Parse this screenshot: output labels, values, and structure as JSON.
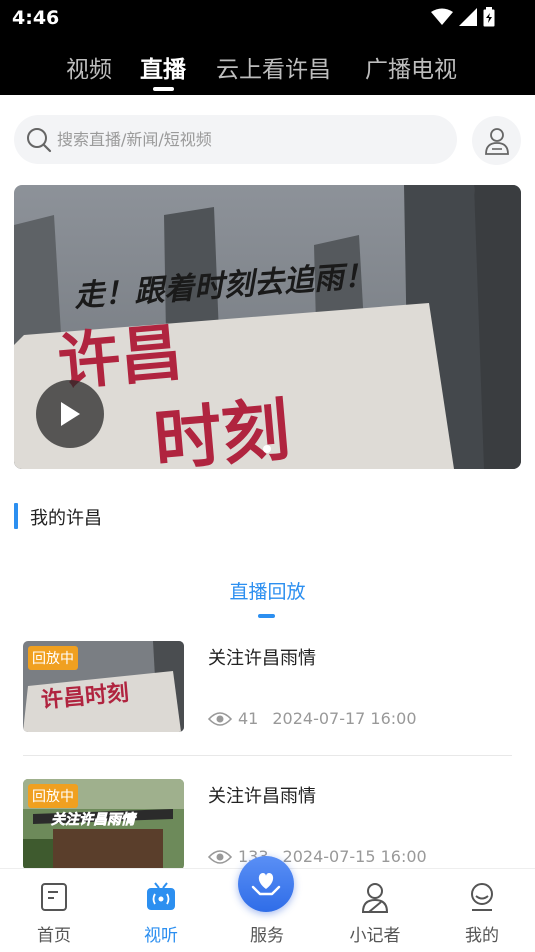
{
  "status_bar": {
    "time": "4:46"
  },
  "top_tabs": [
    {
      "label": "视频"
    },
    {
      "label": "直播"
    },
    {
      "label": "云上看许昌"
    },
    {
      "label": "广播电视"
    }
  ],
  "active_top_tab": "直播",
  "search": {
    "placeholder": "搜索直播/新闻/短视频"
  },
  "banner": {
    "headline": "走！跟着时刻去追雨！",
    "sign_text_line1": "许昌",
    "sign_text_line2": "时刻",
    "active_dot": 1,
    "dot_count": 1
  },
  "section": {
    "title": "我的许昌"
  },
  "sub_tab": {
    "label": "直播回放"
  },
  "list": [
    {
      "badge": "回放中",
      "title": "关注许昌雨情",
      "views": "41",
      "date": "2024-07-17 16:00",
      "thumb_text": "许昌时刻"
    },
    {
      "badge": "回放中",
      "title": "关注许昌雨情",
      "views": "133",
      "date": "2024-07-15 16:00",
      "thumb_text": "关注许昌雨情"
    }
  ],
  "bottom_nav": [
    {
      "label": "首页",
      "icon": "home-doc-icon"
    },
    {
      "label": "视听",
      "icon": "tv-icon"
    },
    {
      "label": "服务",
      "icon": "heart-hand-icon"
    },
    {
      "label": "小记者",
      "icon": "reporter-icon"
    },
    {
      "label": "我的",
      "icon": "profile-icon"
    }
  ],
  "active_bottom_nav": "视听",
  "colors": {
    "accent": "#2c8ff0",
    "badge": "#f0a020",
    "topbar": "#000000"
  }
}
